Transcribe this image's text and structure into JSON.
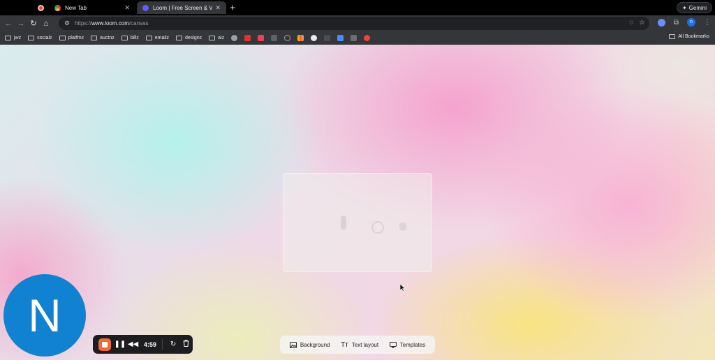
{
  "tabs": [
    {
      "label": "New Tab",
      "close": "✕"
    },
    {
      "label": "Loom | Free Screen & Video R",
      "close": "✕"
    }
  ],
  "new_tab_label": "+",
  "gemini_label": "Gemini",
  "address": {
    "scheme": "https://",
    "host": "www.loom.com",
    "path": "/canvas"
  },
  "bookmarks": [
    "jwz",
    "socialz",
    "platfmz",
    "auctnz",
    "billz",
    "emailz",
    "designz",
    "aiz"
  ],
  "all_bookmarks_label": "All Bookmarks",
  "profile_initial": "n",
  "camera_initial": "N",
  "recorder": {
    "timer": "4:59"
  },
  "canvas_tools": {
    "background": "Background",
    "text_layout": "Text layout",
    "templates": "Templates"
  },
  "colors": {
    "stop": "#f06a3a",
    "camera": "#1181d1",
    "recorder_bg": "#1d1d1f"
  }
}
